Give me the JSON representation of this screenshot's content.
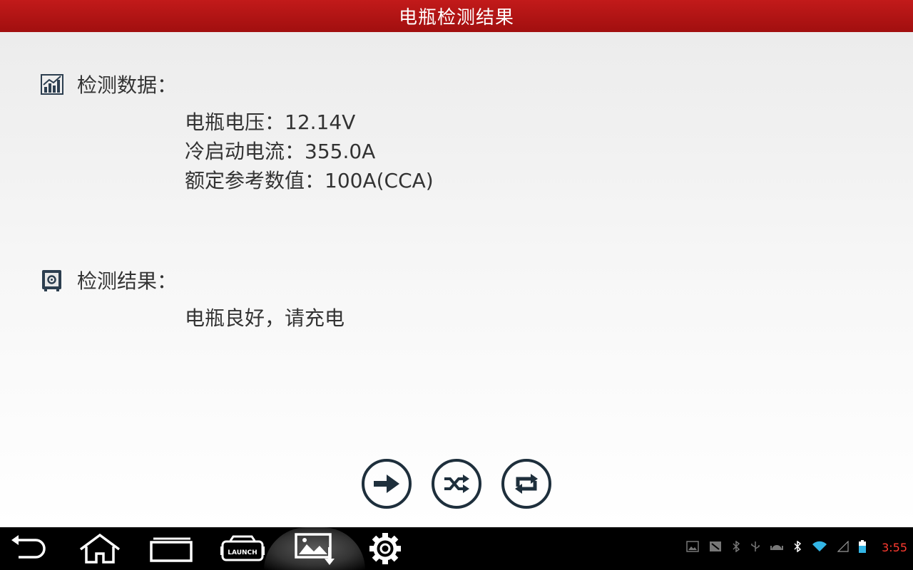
{
  "header": {
    "title": "电瓶检测结果"
  },
  "data_section": {
    "label": "检测数据：",
    "lines": [
      "电瓶电压：12.14V",
      "冷启动电流：355.0A",
      "额定参考数值：100A(CCA)"
    ]
  },
  "result_section": {
    "label": "检测结果：",
    "text": "电瓶良好，请充电"
  },
  "actions": [
    "arrow-right-icon",
    "shuffle-icon",
    "repeat-icon"
  ],
  "navbar": {
    "buttons": [
      "back-icon",
      "home-icon",
      "recent-apps-icon",
      "launch-icon",
      "screenshot-icon",
      "settings-icon"
    ],
    "launch_text": "LAUNCH",
    "clock": "3:55",
    "clock_color": "#ff3b30"
  },
  "colors": {
    "titlebar": "#b31313",
    "icon_dark": "#1e2f3c"
  }
}
